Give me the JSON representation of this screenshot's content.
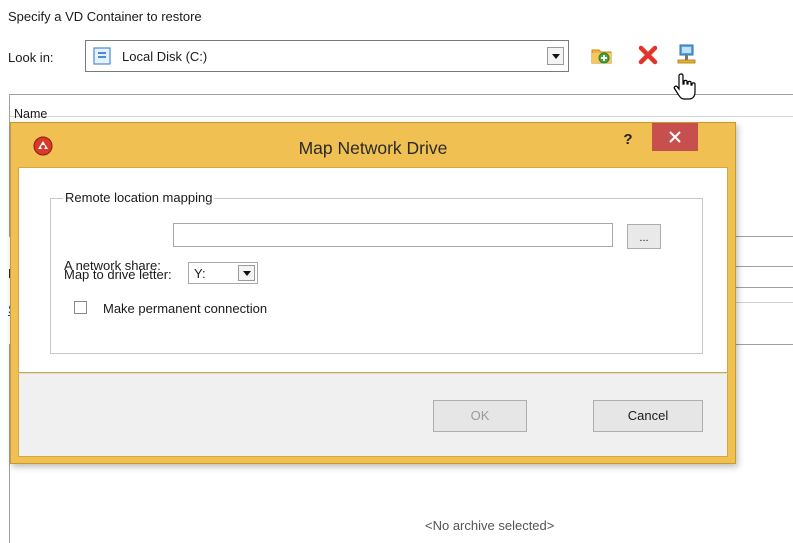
{
  "window": {
    "prompt": "Specify a VD Container to restore",
    "look_in_label": "Look in:",
    "look_in_value": "Local Disk (C:)",
    "toolbar": {
      "new_folder_icon": "new-folder-icon",
      "delete_icon": "delete-icon",
      "map_network_drive_icon": "network-drive-icon"
    },
    "list": {
      "column_name": "Name"
    },
    "fragment_f": "F",
    "fragment_s": "S",
    "no_archive_text": "<No archive selected>"
  },
  "dialog": {
    "title": "Map Network Drive",
    "help_label": "?",
    "group_label": "Remote location mapping",
    "share_label": "A network share:",
    "share_value": "",
    "browse_label": "...",
    "drive_label": "Map to drive letter:",
    "drive_value": "Y:",
    "permanent_label": "Make permanent connection",
    "permanent_checked": false,
    "ok_label": "OK",
    "cancel_label": "Cancel"
  },
  "colors": {
    "dialog_frame": "#f1c052",
    "close_button": "#c7504f",
    "link": "#0645ad"
  }
}
